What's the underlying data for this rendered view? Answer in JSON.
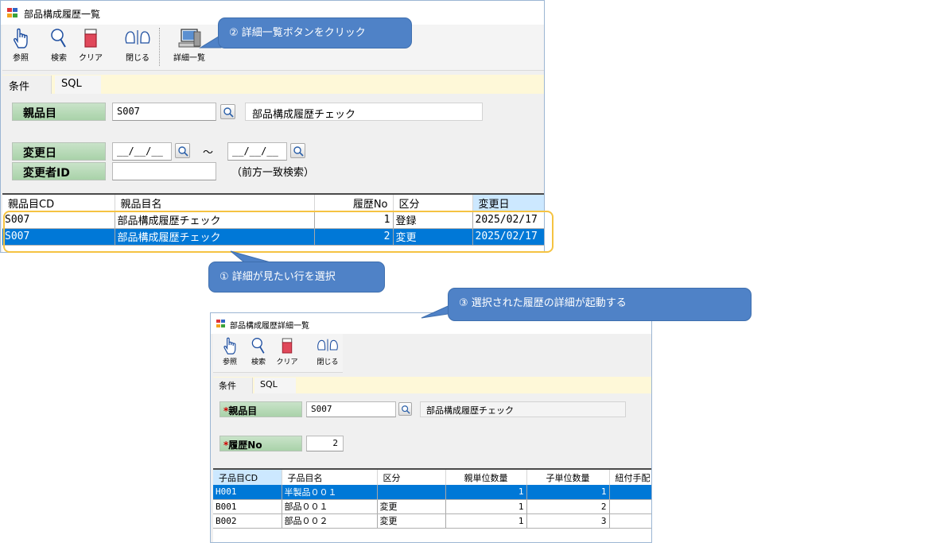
{
  "main_window": {
    "title": "部品構成履歴一覧",
    "toolbar": [
      {
        "label": "参照",
        "icon": "hand-pointer-icon"
      },
      {
        "label": "検索",
        "icon": "magnifier-icon"
      },
      {
        "label": "クリア",
        "icon": "eraser-icon"
      },
      {
        "label": "閉じる",
        "icon": "close-hands-icon"
      },
      {
        "label": "詳細一覧",
        "icon": "computer-icon"
      }
    ],
    "tabs": [
      "条件",
      "SQL"
    ],
    "form": {
      "parent_label": "親品目",
      "parent_code": "S007",
      "parent_name": "部品構成履歴チェック",
      "date_label": "変更日",
      "date_from": "__/__/__",
      "date_tilde": "～",
      "date_to": "__/__/__",
      "changer_label": "変更者ID",
      "changer_value": "",
      "changer_note": "（前方一致検索）"
    },
    "grid": {
      "headers": [
        "親品目CD",
        "親品目名",
        "履歴No",
        "区分",
        "変更日"
      ],
      "sorted_column": "変更日",
      "rows": [
        {
          "code": "S007",
          "name": "部品構成履歴チェック",
          "no": "1",
          "kind": "登録",
          "date": "2025/02/17",
          "selected": false
        },
        {
          "code": "S007",
          "name": "部品構成履歴チェック",
          "no": "2",
          "kind": "変更",
          "date": "2025/02/17",
          "selected": true
        }
      ]
    }
  },
  "detail_window": {
    "title": "部品構成履歴詳細一覧",
    "toolbar": [
      {
        "label": "参照",
        "icon": "hand-pointer-icon"
      },
      {
        "label": "検索",
        "icon": "magnifier-icon"
      },
      {
        "label": "クリア",
        "icon": "eraser-icon"
      },
      {
        "label": "閉じる",
        "icon": "close-hands-icon"
      }
    ],
    "tabs": [
      "条件",
      "SQL"
    ],
    "form": {
      "required_mark": "*",
      "parent_label": "親品目",
      "parent_code": "S007",
      "parent_name": "部品構成履歴チェック",
      "history_label": "履歴No",
      "history_value": "2"
    },
    "grid": {
      "headers": [
        "子品目CD",
        "子品目名",
        "区分",
        "親単位数量",
        "子単位数量",
        "紐付手配"
      ],
      "sorted_column": "子品目CD",
      "rows": [
        {
          "code": "H001",
          "name": "半製品００１",
          "kind": "",
          "parent_qty": "1",
          "child_qty": "1",
          "link": "",
          "selected": true
        },
        {
          "code": "B001",
          "name": "部品００１",
          "kind": "変更",
          "parent_qty": "1",
          "child_qty": "2",
          "link": "",
          "selected": false
        },
        {
          "code": "B002",
          "name": "部品００２",
          "kind": "変更",
          "parent_qty": "1",
          "child_qty": "3",
          "link": "",
          "selected": false
        }
      ]
    }
  },
  "callouts": {
    "step1": "① 詳細が見たい行を選択",
    "step2": "② 詳細一覧ボタンをクリック",
    "step3": "③ 選択された履歴の詳細が起動する"
  },
  "colors": {
    "selected_row": "#0078d7",
    "label_green": "#b5d9b5",
    "callout_blue": "#4f82c7",
    "highlight_border": "#f5c342",
    "tab_strip": "#fef8d8"
  }
}
